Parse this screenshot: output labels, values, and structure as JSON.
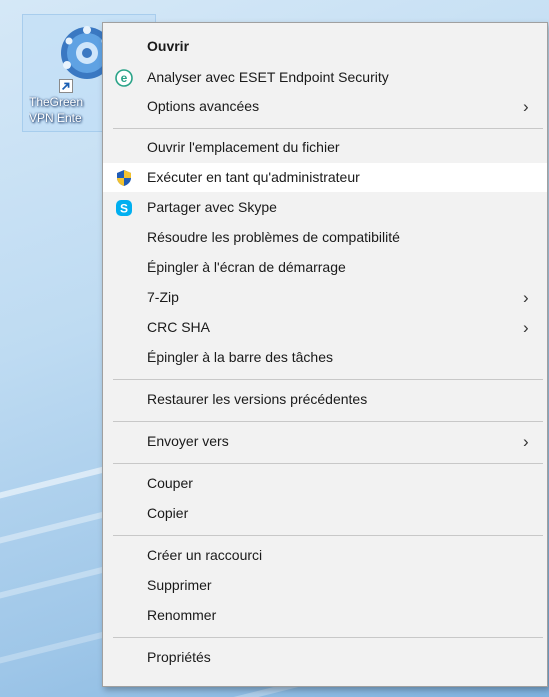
{
  "desktop_icon": {
    "label_line1": "TheGreen",
    "label_line2": "VPN Ente"
  },
  "context_menu": {
    "items": [
      {
        "label": "Ouvrir",
        "bold": true
      },
      {
        "label": "Analyser avec ESET Endpoint Security",
        "icon": "eset-icon"
      },
      {
        "label": "Options avancées",
        "submenu": true
      },
      {
        "label": "Ouvrir l'emplacement du fichier"
      },
      {
        "label": "Exécuter en tant qu'administrateur",
        "icon": "uac-shield-icon"
      },
      {
        "label": "Partager avec Skype",
        "icon": "skype-icon"
      },
      {
        "label": "Résoudre les problèmes de compatibilité"
      },
      {
        "label": "Épingler à l'écran de démarrage"
      },
      {
        "label": "7-Zip",
        "submenu": true
      },
      {
        "label": "CRC SHA",
        "submenu": true
      },
      {
        "label": "Épingler à la barre des tâches"
      },
      {
        "label": "Restaurer les versions précédentes"
      },
      {
        "label": "Envoyer vers",
        "submenu": true
      },
      {
        "label": "Couper"
      },
      {
        "label": "Copier"
      },
      {
        "label": "Créer un raccourci"
      },
      {
        "label": "Supprimer"
      },
      {
        "label": "Renommer"
      },
      {
        "label": "Propriétés"
      }
    ],
    "submenu_glyph": "›",
    "hovered_item": "Exécuter en tant qu'administrateur"
  },
  "colors": {
    "menu_background": "#f2f2f2",
    "hover_background": "#ffffff",
    "eset_green": "#2aa388",
    "skype_blue": "#00aff0",
    "shield_blue": "#1f5bb5",
    "shield_yellow": "#f2c12e"
  }
}
